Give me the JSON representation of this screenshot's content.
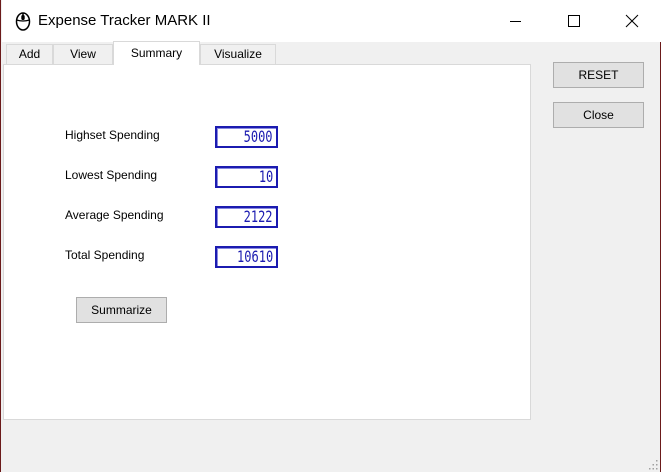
{
  "window": {
    "title": "Expense Tracker MARK II",
    "app_icon": "mouse-icon",
    "controls": {
      "minimize": "minimize-icon",
      "maximize": "maximize-icon",
      "close": "close-icon"
    }
  },
  "tabs": [
    {
      "label": "Add",
      "active": false
    },
    {
      "label": "View",
      "active": false
    },
    {
      "label": "Summary",
      "active": true
    },
    {
      "label": "Visualize",
      "active": false
    }
  ],
  "summary": {
    "rows": [
      {
        "label": "Highset Spending",
        "value": "5000"
      },
      {
        "label": "Lowest Spending",
        "value": "10"
      },
      {
        "label": "Average Spending",
        "value": "2122"
      },
      {
        "label": "Total Spending",
        "value": "10610"
      }
    ],
    "summarize_label": "Summarize"
  },
  "side_buttons": {
    "reset_label": "RESET",
    "close_label": "Close"
  },
  "colors": {
    "lcd": "#1b1bb0",
    "panel": "#ffffff",
    "window_bg": "#f0f0f0",
    "frame": "#6b1a1a"
  }
}
